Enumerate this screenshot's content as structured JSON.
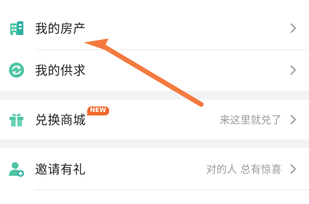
{
  "menu": {
    "group1": [
      {
        "label": "我的房产",
        "icon": "building-icon"
      },
      {
        "label": "我的供求",
        "icon": "exchange-icon"
      }
    ],
    "group2": [
      {
        "label": "兑换商城",
        "icon": "gift-icon",
        "badge": "NEW",
        "hint": "来这里就兑了"
      }
    ],
    "group3": [
      {
        "label": "邀请有礼",
        "icon": "invite-user-icon",
        "hint": "对的人 总有惊喜"
      }
    ]
  },
  "colors": {
    "accent": "#f2692a",
    "icon_green": "#4fc4a5",
    "background": "#f2f3f5"
  }
}
